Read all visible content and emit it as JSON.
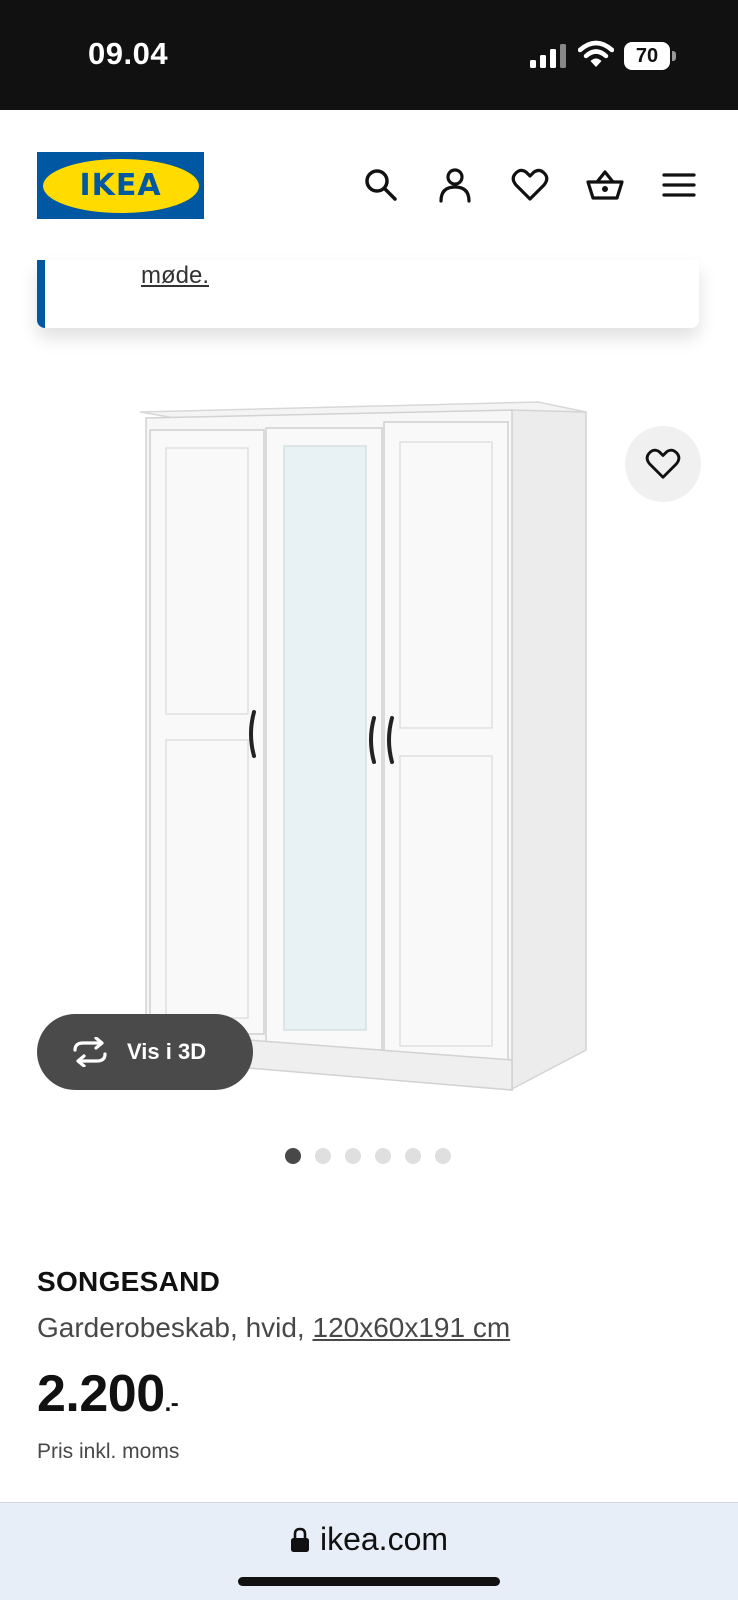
{
  "status_bar": {
    "time": "09.04",
    "battery": "70",
    "icons": [
      "signal-icon",
      "wifi-icon",
      "battery-icon"
    ]
  },
  "header": {
    "logo_text": "IKEA",
    "icons": [
      "search-icon",
      "account-icon",
      "heart-icon",
      "basket-icon",
      "menu-icon"
    ]
  },
  "banner": {
    "link_text": "møde."
  },
  "gallery": {
    "view_3d_label": "Vis i 3D",
    "image_count": 6,
    "active_index": 0
  },
  "product": {
    "name": "SONGESAND",
    "description": "Garderobeskab, hvid, ",
    "dimensions": "120x60x191 cm",
    "price": "2.200",
    "price_suffix": ".-",
    "price_note": "Pris inkl. moms"
  },
  "browser": {
    "url": "ikea.com"
  },
  "colors": {
    "brand_blue": "#0058a3",
    "brand_yellow": "#ffdb00",
    "text_dark": "#111111",
    "text_muted": "#484848"
  }
}
